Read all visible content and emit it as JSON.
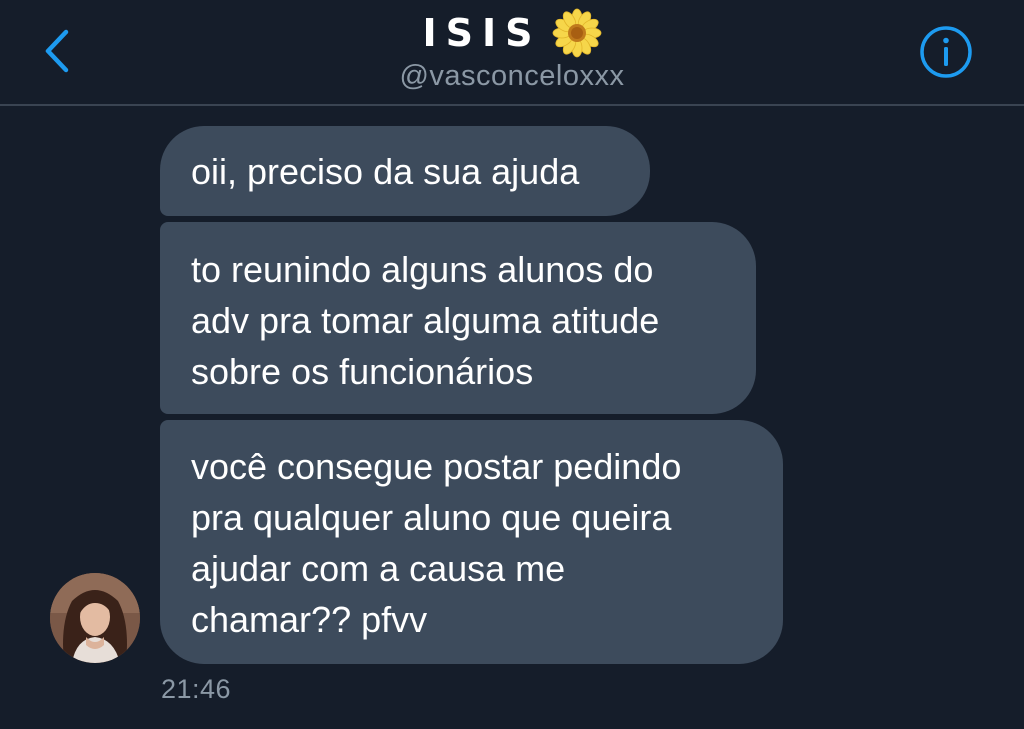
{
  "header": {
    "title": "ISIS",
    "title_emoji": "blossom-icon",
    "handle": "@vasconceloxxx",
    "back_icon": "chevron-left-icon",
    "info_icon": "info-icon"
  },
  "messages": [
    {
      "text": "oii, preciso da sua ajuda"
    },
    {
      "text": "to reunindo alguns alunos do\nadv pra tomar alguma atitude\nsobre os funcionários"
    },
    {
      "text": "você consegue postar pedindo\npra qualquer aluno que queira\najudar com a causa me\nchamar?? pfvv"
    }
  ],
  "timestamp": "21:46",
  "colors": {
    "background": "#151d2a",
    "bubble": "#3d4b5c",
    "accent": "#1d9bf0",
    "muted": "#8b98a5"
  }
}
